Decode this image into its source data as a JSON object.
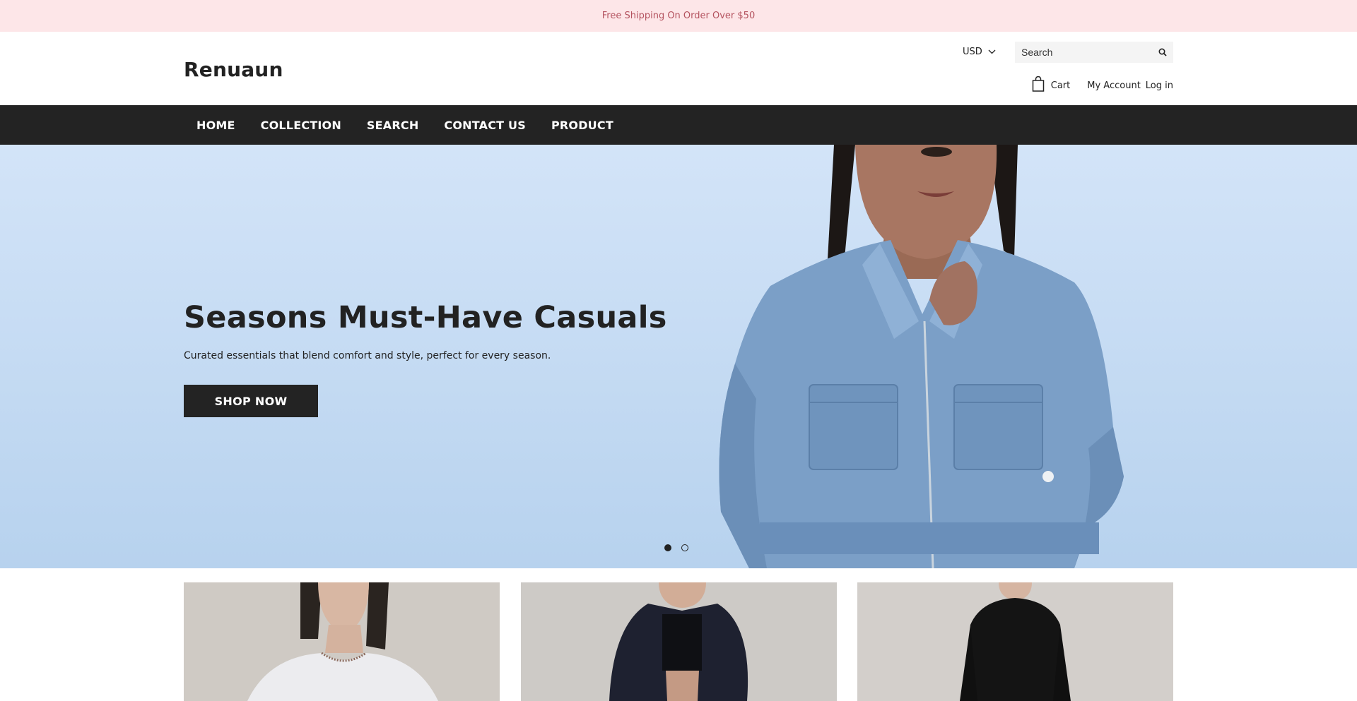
{
  "announcement": "Free Shipping On Order Over $50",
  "header": {
    "logo": "Renuaun",
    "currency": "USD",
    "search_placeholder": "Search",
    "cart_label": "Cart",
    "account_label": "My Account",
    "login_label": "Log in"
  },
  "nav": {
    "items": [
      "HOME",
      "COLLECTION",
      "SEARCH",
      "CONTACT US",
      "PRODUCT"
    ]
  },
  "hero": {
    "title": "Seasons Must-Have Casuals",
    "subtitle": "Curated essentials that blend comfort and style, perfect for every season.",
    "button": "SHOP NOW",
    "slide_count": 2,
    "active_slide": 1
  },
  "colors": {
    "announcement_bg": "#fde6e8",
    "announcement_text": "#b4535f",
    "nav_bg": "#232323",
    "hero_bg_top": "#d3e4f8",
    "hero_bg_bottom": "#b7d2ee",
    "button_bg": "#232323"
  },
  "icons": {
    "search": "search-icon",
    "currency_dropdown": "chevron-down-icon",
    "cart": "shopping-bag-icon"
  }
}
